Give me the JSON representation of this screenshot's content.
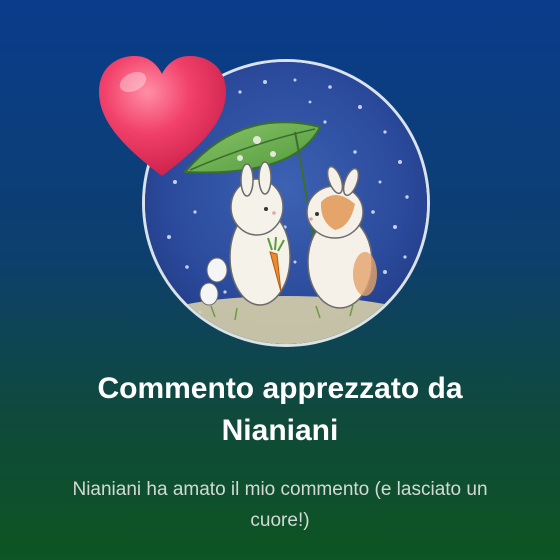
{
  "notification": {
    "title": "Commento apprezzato da Nianiani",
    "message": "Nianiani ha amato il mio commento (e lasciato un cuore!)",
    "icons": {
      "reaction": "heart-icon",
      "avatar": "profile-picture-bunnies-under-leaf"
    },
    "colors": {
      "heart": "#e8305a",
      "title": "#ffffff",
      "message": "#d3d9d4",
      "background_top": "#0a3c8c",
      "background_bottom": "#0d5522"
    }
  }
}
